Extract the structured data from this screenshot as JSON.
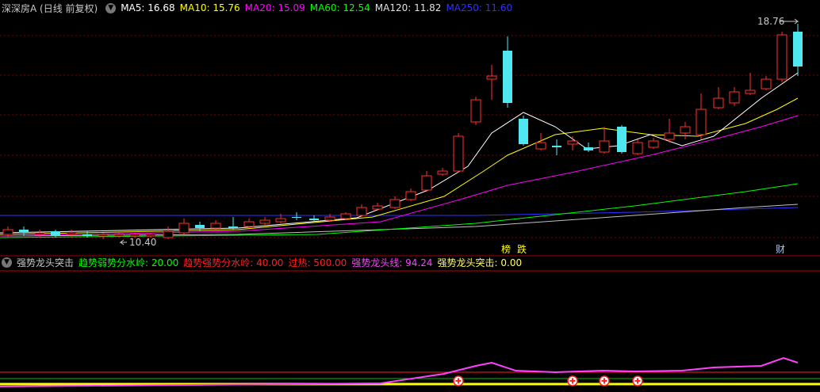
{
  "header": {
    "stock_title": "深深房A (日线 前复权)",
    "ma": [
      {
        "label": "MA5: 16.68",
        "color": "#ffffff"
      },
      {
        "label": "MA10: 15.76",
        "color": "#ffff00"
      },
      {
        "label": "MA20: 15.09",
        "color": "#ff00ff"
      },
      {
        "label": "MA60: 12.54",
        "color": "#00ff00"
      },
      {
        "label": "MA120: 11.82",
        "color": "#e0e0e0"
      },
      {
        "label": "MA250: 11.60",
        "color": "#3030ff"
      }
    ]
  },
  "main_chart": {
    "high_label": "18.76",
    "low_label": "10.40",
    "markers": [
      {
        "text": "榜",
        "color": "#ffff00"
      },
      {
        "text": "跌",
        "color": "#ffff00"
      },
      {
        "text": "财",
        "color": "#a0c8ff"
      }
    ]
  },
  "indicator": {
    "name": "强势龙头突击",
    "params": [
      {
        "label": "趋势弱势分水岭: 20.00",
        "color": "#00ff00"
      },
      {
        "label": "趋势强势分水岭: 40.00",
        "color": "#ff2020"
      },
      {
        "label": "过热: 500.00",
        "color": "#ff2020"
      },
      {
        "label": "强势龙头线: 94.24",
        "color": "#ff40ff"
      },
      {
        "label": "强势龙头突击: 0.00",
        "color": "#ffff60"
      }
    ]
  },
  "colors": {
    "up": "#ff3030",
    "down": "#50e8f0",
    "grid": "#800000"
  }
}
